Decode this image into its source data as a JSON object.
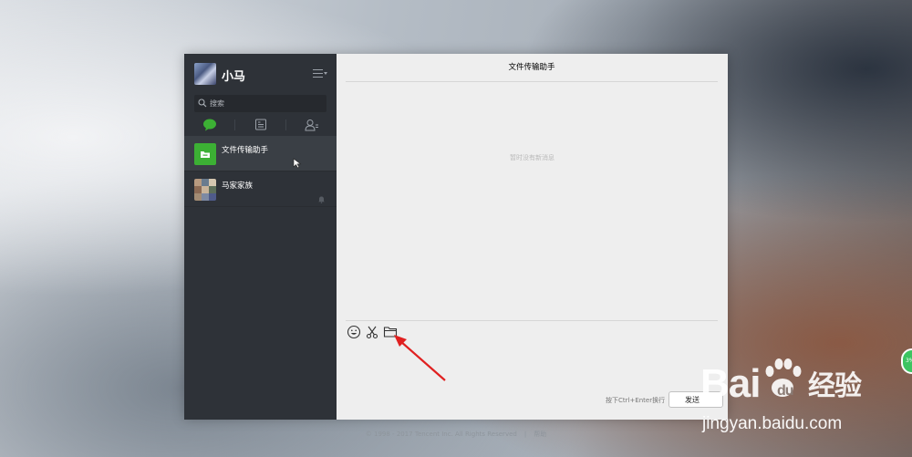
{
  "profile": {
    "nickname": "小马",
    "menu_icon": "menu-icon"
  },
  "search": {
    "placeholder": "搜索"
  },
  "tabs": [
    {
      "id": "chats",
      "icon": "chat-bubble-icon",
      "active_color": "#3cb034"
    },
    {
      "id": "articles",
      "icon": "document-icon"
    },
    {
      "id": "contacts",
      "icon": "contacts-icon"
    }
  ],
  "chats": [
    {
      "name": "文件传输助手",
      "icon": "file-transfer-icon",
      "icon_color": "#3cb034",
      "active": true
    },
    {
      "name": "马家家族",
      "icon": "group-avatar",
      "muted": true
    }
  ],
  "conversation": {
    "title": "文件传输助手",
    "empty_text": "暂时没有新消息",
    "toolbar": [
      "emoji-icon",
      "scissors-icon",
      "folder-icon"
    ],
    "hint": "按下Ctrl+Enter换行",
    "send_label": "发送"
  },
  "footer": {
    "copyright": "© 1998 - 2017 Tencent Inc. All Rights Reserved",
    "separator": "|",
    "help": "帮助"
  },
  "float_button": {
    "label": "3%"
  },
  "watermark": {
    "logo": "Bai du 经验",
    "url": "jingyan.baidu.com"
  },
  "annotation": {
    "type": "arrow",
    "color": "#e02020"
  }
}
